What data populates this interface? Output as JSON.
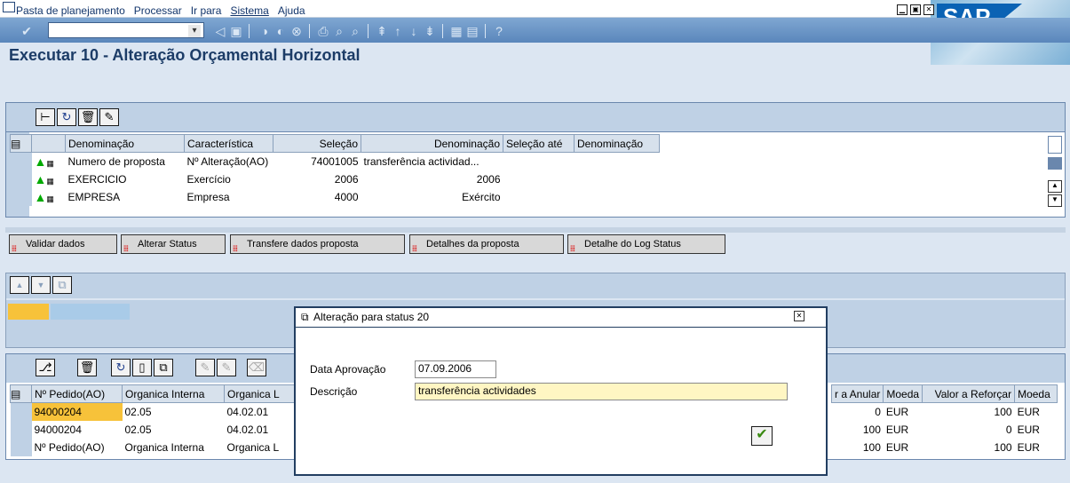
{
  "menu": {
    "items": [
      "Pasta de planejamento",
      "Processar",
      "Ir para",
      "Sistema",
      "Ajuda"
    ]
  },
  "window": {
    "title": "Executar 10 - Alteração Orçamental Horizontal",
    "logo": "SAP"
  },
  "selection_grid": {
    "headers": [
      "Denominação",
      "Característica",
      "Seleção",
      "Denominação",
      "Seleção até",
      "Denominação"
    ],
    "rows": [
      [
        "Numero de proposta",
        "Nº Alteração(AO)",
        "74001005",
        "transferência actividad...",
        "",
        ""
      ],
      [
        "EXERCICIO",
        "Exercício",
        "2006",
        "2006",
        "",
        ""
      ],
      [
        "EMPRESA",
        "Empresa",
        "4000",
        "Exército",
        "",
        ""
      ]
    ]
  },
  "actions": [
    "Validar dados",
    "Alterar Status",
    "Transfere dados proposta",
    "Detalhes da proposta",
    "Detalhe do Log Status"
  ],
  "lower_grid": {
    "headers_left": [
      "Nº Pedido(AO)",
      "Organica Interna",
      "Organica L"
    ],
    "headers_right": [
      "r a Anular",
      "Moeda",
      "Valor a Reforçar",
      "Moeda"
    ],
    "rows": [
      {
        "left": [
          "94000204",
          "02.05",
          "04.02.01"
        ],
        "right": [
          "0",
          "EUR",
          "100",
          "EUR"
        ]
      },
      {
        "left": [
          "94000204",
          "02.05",
          "04.02.01"
        ],
        "right": [
          "100",
          "EUR",
          "0",
          "EUR"
        ]
      },
      {
        "left": [
          "Nº Pedido(AO)",
          "Organica Interna",
          "Organica L"
        ],
        "right": [
          "100",
          "EUR",
          "100",
          "EUR"
        ]
      }
    ]
  },
  "dialog": {
    "title": "Alteração para status 20",
    "fields": {
      "date_label": "Data Aprovação",
      "date_value": "07.09.2006",
      "desc_label": "Descrição",
      "desc_value": "transferência actividades"
    }
  }
}
